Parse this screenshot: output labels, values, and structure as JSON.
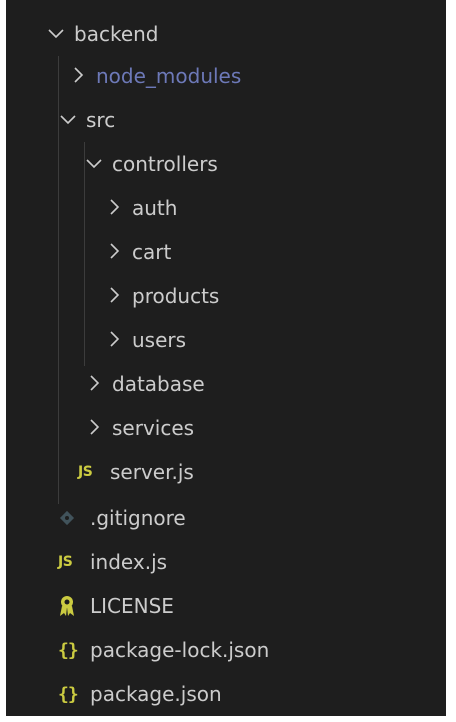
{
  "tree": {
    "backend": "backend",
    "node_modules": "node_modules",
    "src": "src",
    "controllers": "controllers",
    "auth": "auth",
    "cart": "cart",
    "products": "products",
    "users": "users",
    "database": "database",
    "services": "services",
    "server_js": "server.js",
    "gitignore": ".gitignore",
    "index_js": "index.js",
    "license": "LICENSE",
    "package_lock": "package-lock.json",
    "package_json": "package.json"
  },
  "icons": {
    "js": "JS",
    "json": "{}"
  },
  "colors": {
    "background": "#1e1e1e",
    "text": "#cccccc",
    "ignored_text": "#6d79b8",
    "js_icon": "#cbcb41",
    "license_icon": "#cbcb41"
  }
}
